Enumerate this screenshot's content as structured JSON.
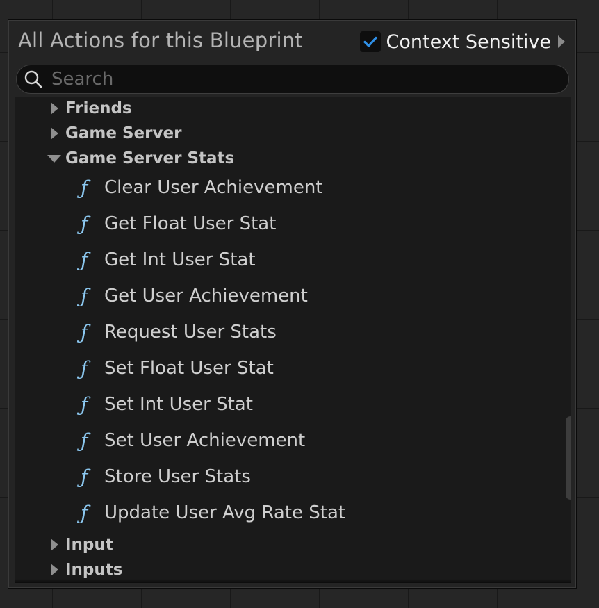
{
  "panel": {
    "title": "All Actions for this Blueprint",
    "context_sensitive_label": "Context Sensitive",
    "context_sensitive_checked": true
  },
  "search": {
    "placeholder": "Search",
    "value": ""
  },
  "colors": {
    "accent_check": "#2f8fe6",
    "function_icon": "#8cc8f0",
    "panel_bg": "#242424",
    "tree_bg": "#1a1a1a"
  },
  "tree": {
    "categories_before": [
      {
        "label": "Friends",
        "expanded": false
      },
      {
        "label": "Game Server",
        "expanded": false
      }
    ],
    "expanded_category": {
      "label": "Game Server Stats",
      "expanded": true,
      "icon": "function-icon",
      "icon_glyph": "ƒ",
      "items": [
        "Clear User Achievement",
        "Get Float User Stat",
        "Get Int User Stat",
        "Get User Achievement",
        "Request User Stats",
        "Set Float User Stat",
        "Set Int User Stat",
        "Set User Achievement",
        "Store User Stats",
        "Update User Avg Rate Stat"
      ]
    },
    "categories_after": [
      {
        "label": "Input",
        "expanded": false
      },
      {
        "label": "Inputs",
        "expanded": false
      }
    ]
  }
}
